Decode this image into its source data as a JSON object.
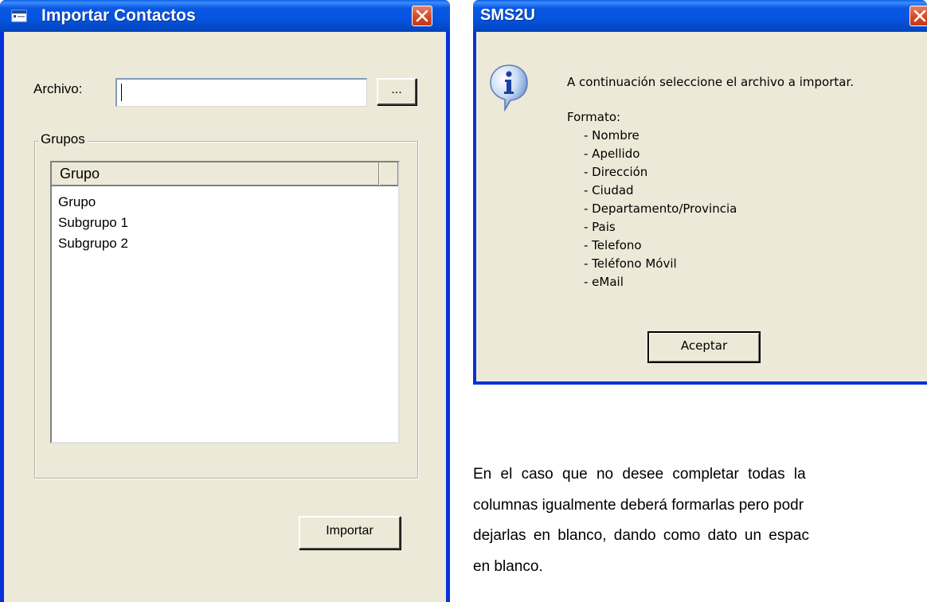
{
  "import_dialog": {
    "title": "Importar Contactos",
    "file_label": "Archivo:",
    "file_value": "",
    "browse_label": "...",
    "groups_legend": "Grupos",
    "column_header": "Grupo",
    "rows": [
      "Grupo",
      "Subgrupo 1",
      "Subgrupo 2"
    ],
    "import_label": "Importar"
  },
  "message_box": {
    "title": "SMS2U",
    "icon": "info-icon",
    "intro": "A continuación seleccione el archivo a importar.",
    "format_label": "Formato:",
    "fields": [
      "- Nombre",
      "- Apellido",
      "- Dirección",
      "- Ciudad",
      "- Departamento/Provincia",
      "- Pais",
      "- Telefono",
      "- Teléfono Móvil",
      "- eMail"
    ],
    "ok_label": "Aceptar"
  },
  "document": {
    "lines": [
      "En el caso que no desee completar todas la",
      "columnas igualmente deberá formarlas pero podr",
      "dejarlas en blanco, dando como dato un espac",
      "en blanco."
    ]
  },
  "colors": {
    "titlebar": "#0558e0",
    "dialog_face": "#ece9d8",
    "close_button": "#d44a26"
  }
}
